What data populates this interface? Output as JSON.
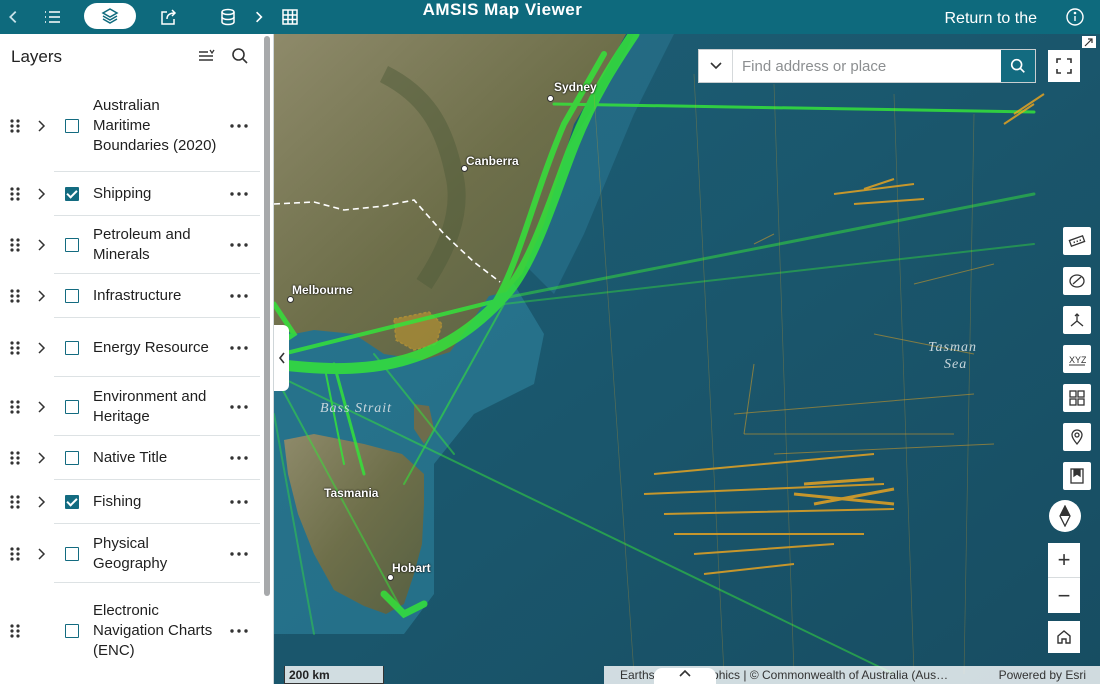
{
  "header": {
    "title": "AMSIS Map Viewer",
    "return_label": "Return to the",
    "icons": [
      "chevron-left-icon",
      "list-icon",
      "layers-icon",
      "share-icon",
      "database-icon",
      "chevron-right-icon",
      "table-icon",
      "info-icon"
    ]
  },
  "layers_panel": {
    "title": "Layers",
    "items": [
      {
        "label": "Australian Maritime Boundaries (2020)",
        "checked": false
      },
      {
        "label": "Shipping",
        "checked": true
      },
      {
        "label": "Petroleum and Minerals",
        "checked": false
      },
      {
        "label": "Infrastructure",
        "checked": false
      },
      {
        "label": "Energy Resource",
        "checked": false
      },
      {
        "label": "Environment and Heritage",
        "checked": false
      },
      {
        "label": "Native Title",
        "checked": false
      },
      {
        "label": "Fishing",
        "checked": true
      },
      {
        "label": "Physical Geography",
        "checked": false
      },
      {
        "label": "Electronic Navigation Charts (ENC)",
        "checked": false
      }
    ]
  },
  "search": {
    "placeholder": "Find address or place"
  },
  "map": {
    "places": {
      "sydney": "Sydney",
      "canberra": "Canberra",
      "melbourne": "Melbourne",
      "tasmania": "Tasmania",
      "hobart": "Hobart"
    },
    "seas": {
      "bass_strait": "Bass Strait",
      "tasman_1": "Tasman",
      "tasman_2": "Sea"
    },
    "scale": "200 km",
    "attribution": "Earthstar Geographics | © Commonwealth of Australia (Aus…",
    "powered_by": "Powered by Esri",
    "colors": {
      "shipping": "#35e33a",
      "fishing": "#f2a81d",
      "ocean": "#1f5d73",
      "brand": "#0e6a7d"
    }
  }
}
